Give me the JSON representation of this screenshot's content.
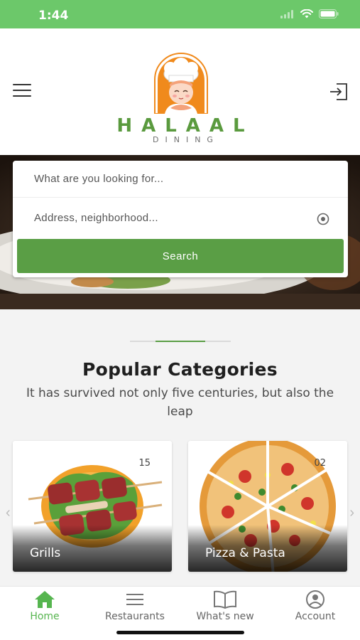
{
  "status_bar": {
    "time": "1:44",
    "icons": [
      "signal-icon",
      "wifi-icon",
      "battery-icon"
    ],
    "background": "#6cc86a"
  },
  "header": {
    "menu_icon": "hamburger-menu-icon",
    "login_icon": "login-icon",
    "logo": {
      "title": "HALAAL",
      "subtitle": "DINING",
      "title_color": "#5a9a3e",
      "badge_color": "#f08a1c"
    }
  },
  "search": {
    "query_placeholder": "What are you looking for...",
    "address_placeholder": "Address, neighborhood...",
    "locate_icon": "locate-icon",
    "button_label": "Search",
    "button_color": "#5a9e45"
  },
  "categories_section": {
    "title": "Popular Categories",
    "subtitle": "It has survived not only five centuries, but also the leap",
    "accent": "#5a9e45",
    "items": [
      {
        "label": "Grills",
        "count": "15"
      },
      {
        "label": "Pizza & Pasta",
        "count": "02"
      }
    ],
    "prev_icon": "chevron-left-icon",
    "next_icon": "chevron-right-icon"
  },
  "bottom_nav": {
    "active_color": "#56b54f",
    "items": [
      {
        "label": "Home",
        "icon": "home-icon",
        "active": true
      },
      {
        "label": "Restaurants",
        "icon": "list-icon",
        "active": false
      },
      {
        "label": "What's new",
        "icon": "book-icon",
        "active": false
      },
      {
        "label": "Account",
        "icon": "user-icon",
        "active": false
      }
    ]
  }
}
